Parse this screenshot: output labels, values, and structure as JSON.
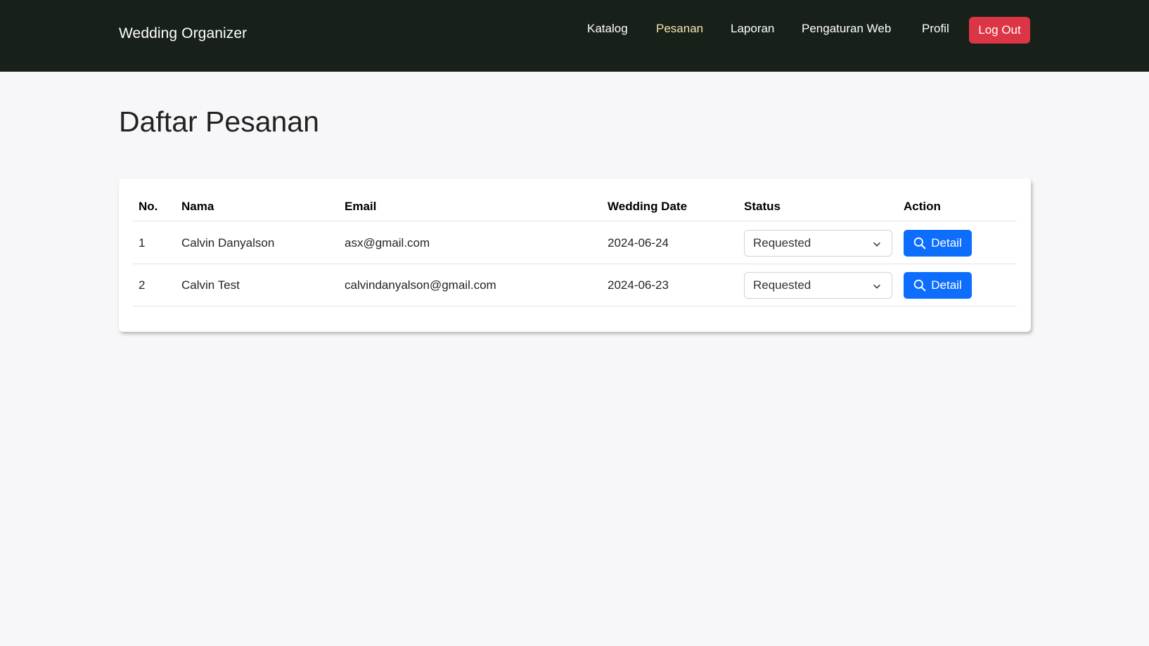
{
  "navbar": {
    "brand": "Wedding Organizer",
    "links": [
      "Katalog",
      "Pesanan",
      "Laporan",
      "Pengaturan Web",
      "Profil"
    ],
    "active": "Pesanan",
    "logout_label": "Log Out"
  },
  "page": {
    "title": "Daftar Pesanan"
  },
  "table": {
    "headers": [
      "No.",
      "Nama",
      "Email",
      "Wedding Date",
      "Status",
      "Action"
    ],
    "rows": [
      {
        "no": "1",
        "nama": "Calvin Danyalson",
        "email": "asx@gmail.com",
        "wedding_date": "2024-06-24",
        "status": "Requested",
        "action": "Detail"
      },
      {
        "no": "2",
        "nama": "Calvin Test",
        "email": "calvindanyalson@gmail.com",
        "wedding_date": "2024-06-23",
        "status": "Requested",
        "action": "Detail"
      }
    ]
  },
  "colors": {
    "navbar": "#182119",
    "logout": "#dc3545",
    "detail": "#0d6efd",
    "active_link": "#f3e6b0"
  },
  "icons": {
    "detail": "search-icon",
    "status": "chevron-down-icon"
  }
}
